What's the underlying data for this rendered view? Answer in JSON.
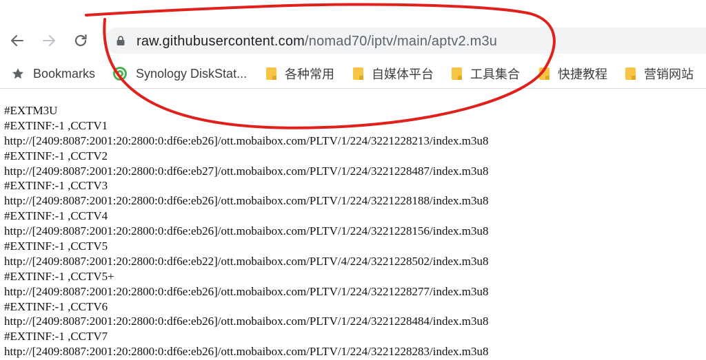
{
  "browser": {
    "url_host": "raw.githubusercontent.com",
    "url_path": "/nomad70/iptv/main/aptv2.m3u",
    "bookmarks_label": "Bookmarks",
    "bookmark_items": [
      {
        "label": "Synology DiskStat...",
        "icon": "synology-icon"
      },
      {
        "label": "各种常用",
        "icon": "folder-icon"
      },
      {
        "label": "自媒体平台",
        "icon": "folder-icon"
      },
      {
        "label": "工具集合",
        "icon": "folder-icon"
      },
      {
        "label": "快捷教程",
        "icon": "folder-icon"
      },
      {
        "label": "营销网站",
        "icon": "folder-icon"
      }
    ]
  },
  "file": {
    "lines": [
      "#EXTM3U",
      "#EXTINF:-1 ,CCTV1",
      "http://[2409:8087:2001:20:2800:0:df6e:eb26]/ott.mobaibox.com/PLTV/1/224/3221228213/index.m3u8",
      "#EXTINF:-1 ,CCTV2",
      "http://[2409:8087:2001:20:2800:0:df6e:eb27]/ott.mobaibox.com/PLTV/1/224/3221228487/index.m3u8",
      "#EXTINF:-1 ,CCTV3",
      "http://[2409:8087:2001:20:2800:0:df6e:eb26]/ott.mobaibox.com/PLTV/1/224/3221228188/index.m3u8",
      "#EXTINF:-1 ,CCTV4",
      "http://[2409:8087:2001:20:2800:0:df6e:eb26]/ott.mobaibox.com/PLTV/1/224/3221228156/index.m3u8",
      "#EXTINF:-1 ,CCTV5",
      "http://[2409:8087:2001:20:2800:0:df6e:eb22]/ott.mobaibox.com/PLTV/4/224/3221228502/index.m3u8",
      "#EXTINF:-1 ,CCTV5+",
      "http://[2409:8087:2001:20:2800:0:df6e:eb26]/ott.mobaibox.com/PLTV/1/224/3221228277/index.m3u8",
      "#EXTINF:-1 ,CCTV6",
      "http://[2409:8087:2001:20:2800:0:df6e:eb26]/ott.mobaibox.com/PLTV/1/224/3221228484/index.m3u8",
      "#EXTINF:-1 ,CCTV7",
      "http://[2409:8087:2001:20:2800:0:df6e:eb26]/ott.mobaibox.com/PLTV/1/224/3221228283/index.m3u8"
    ]
  },
  "colors": {
    "annotation": "#e0201b",
    "omnibox_bg": "#f1f3f4",
    "folder": "#f7c443",
    "synology": "#4caf50"
  }
}
